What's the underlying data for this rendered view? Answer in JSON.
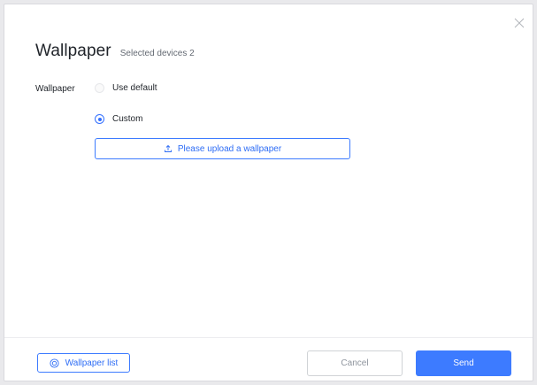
{
  "dialog": {
    "title": "Wallpaper",
    "subtitle": "Selected devices 2",
    "close_icon": "close-icon"
  },
  "form": {
    "field_label": "Wallpaper",
    "options": [
      {
        "label": "Use default",
        "checked": false
      },
      {
        "label": "Custom",
        "checked": true
      }
    ],
    "upload_label": "Please upload a wallpaper",
    "upload_icon": "upload-icon"
  },
  "footer": {
    "list_label": "Wallpaper list",
    "list_icon": "list-circle-icon",
    "cancel_label": "Cancel",
    "send_label": "Send"
  },
  "colors": {
    "accent": "#3d7bff",
    "text": "#1f2329",
    "muted": "#646a73"
  }
}
